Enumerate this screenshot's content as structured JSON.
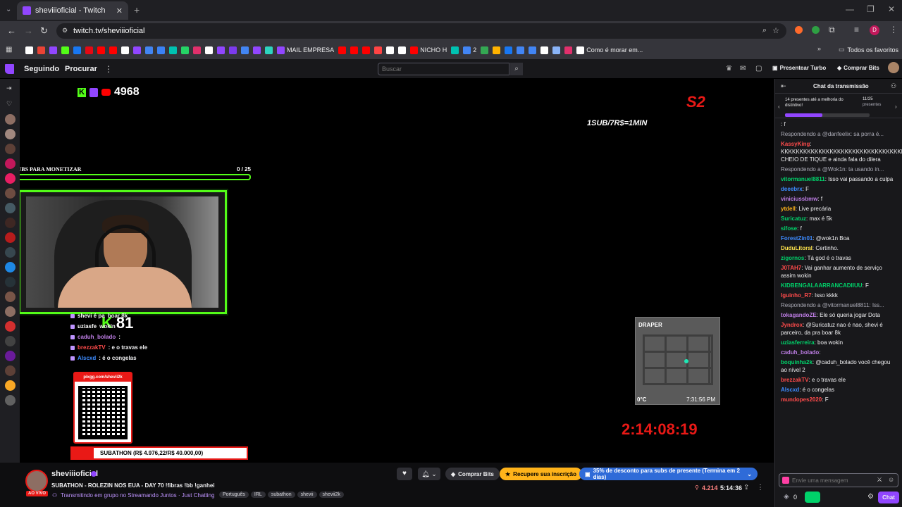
{
  "browser": {
    "tab_title": "sheviiioficial - Twitch",
    "url": "twitch.tv/sheviiioficial",
    "new_tab": "+",
    "bookmarks": [
      {
        "label": "",
        "color": "#ffffff"
      },
      {
        "label": "",
        "color": "#ea4335"
      },
      {
        "label": "",
        "color": "#9146ff"
      },
      {
        "label": "",
        "color": "#53fc18"
      },
      {
        "label": "",
        "color": "#1877f2"
      },
      {
        "label": "",
        "color": "#e50914"
      },
      {
        "label": "",
        "color": "#ff0000"
      },
      {
        "label": "",
        "color": "#ff0000"
      },
      {
        "label": "",
        "color": "#ffffff"
      },
      {
        "label": "",
        "color": "#9146ff"
      },
      {
        "label": "",
        "color": "#4285f4"
      },
      {
        "label": "",
        "color": "#3b82f6"
      },
      {
        "label": "",
        "color": "#00c2b2"
      },
      {
        "label": "",
        "color": "#25d366"
      },
      {
        "label": "",
        "color": "#e1306c"
      },
      {
        "label": "",
        "color": "#ffffff"
      },
      {
        "label": "",
        "color": "#9146ff"
      },
      {
        "label": "",
        "color": "#7c3aed"
      },
      {
        "label": "",
        "color": "#4285f4"
      },
      {
        "label": "",
        "color": "#9146ff"
      },
      {
        "label": "",
        "color": "#2dd4bf"
      },
      {
        "label": "MAIL EMPRESA",
        "color": "#9146ff"
      },
      {
        "label": "",
        "color": "#ff0000"
      },
      {
        "label": "",
        "color": "#ff0000"
      },
      {
        "label": "",
        "color": "#ff0000"
      },
      {
        "label": "",
        "color": "#ff4444"
      },
      {
        "label": "",
        "color": "#ffffff"
      },
      {
        "label": "",
        "color": "#ffffff"
      },
      {
        "label": "NICHO H",
        "color": "#ff0000"
      },
      {
        "label": "",
        "color": "#00c2b2"
      },
      {
        "label": "2",
        "color": "#4285f4"
      },
      {
        "label": "",
        "color": "#34a853"
      },
      {
        "label": "",
        "color": "#ffb300"
      },
      {
        "label": "",
        "color": "#1877f2"
      },
      {
        "label": "",
        "color": "#4285f4"
      },
      {
        "label": "",
        "color": "#4285f4"
      },
      {
        "label": "",
        "color": "#ffffff"
      },
      {
        "label": "",
        "color": "#8ab4f8"
      },
      {
        "label": "",
        "color": "#e1306c"
      },
      {
        "label": "Como é morar em...",
        "color": "#ffffff"
      }
    ],
    "all_favorites": "Todos os favoritos"
  },
  "twitch_header": {
    "following": "Seguindo",
    "browse": "Procurar",
    "search_placeholder": "Buscar",
    "turbo": "Presentear Turbo",
    "bits": "Comprar Bits"
  },
  "overlay": {
    "kick_count": "4968",
    "subs_label": "SUBS PARA MONETIZAR",
    "subs_progress": "0 / 25",
    "subs_fraction": 0,
    "sub_rate": "1SUB/7R$=1MIN",
    "kick_viewers": "81",
    "qr_label": "pixgg.com/shevii2k",
    "subathon": "SUBATHON (R$ 4.976,22/R$ 40.000,00)",
    "subathon_fraction": 0.124,
    "timer": "2:14:08:19",
    "map_title": "DRAPER",
    "map_temp": "0°C",
    "map_time": "7:31:56 PM",
    "stream_chat": [
      {
        "user": "shevi é pa",
        "text": "boar 8k",
        "color": "#ffffff"
      },
      {
        "user": "uziasfe",
        "text": "wokin",
        "color": "#ffffff"
      },
      {
        "user": "caduh_bolado",
        "text": ":",
        "color": "#bf7ee6"
      },
      {
        "user": "brezzakTV",
        "text": ": e o travas ele",
        "color": "#ff4b4b"
      },
      {
        "user": "Alscxd",
        "text": ": é o congelas",
        "color": "#3d8bff"
      }
    ]
  },
  "chat": {
    "header": "Chat da transmissão",
    "gifts": "14 presentes até a melhoria do distintivo!",
    "gift_count": "11/25",
    "gift_count_label": "presentes",
    "gift_fraction": 0.44,
    "messages": [
      {
        "reply": "",
        "user": "",
        "text": ": f",
        "color": "#ff4b4b"
      },
      {
        "reply": "Respondendo a @danfeelix: sa porra é...",
        "user": "",
        "text": "",
        "color": "#adadb8"
      },
      {
        "reply": "",
        "user": "KassyKing",
        "text": ": KKKKKKKKKKKKKKKKKKKKKKKKKKKKKKKKKK CHEIO DE TIQUE e ainda fala do dilera",
        "color": "#ff4b4b"
      },
      {
        "reply": "Respondendo a @Wok1n: ta usando in...",
        "user": "",
        "text": "",
        "color": "#adadb8"
      },
      {
        "reply": "",
        "user": "vitormanuel8811",
        "text": ": Isso vai passando a culpa",
        "color": "#00d26a"
      },
      {
        "reply": "",
        "user": "deeebrx",
        "text": ": F",
        "color": "#3d8bff"
      },
      {
        "reply": "",
        "user": "viniciussbmw",
        "text": ": f",
        "color": "#bf7ee6"
      },
      {
        "reply": "",
        "user": "ytdell",
        "text": ": Live precária",
        "color": "#ffb31a"
      },
      {
        "reply": "",
        "user": "Suricatuz",
        "text": ": max é 5k",
        "color": "#00d26a"
      },
      {
        "reply": "",
        "user": "sifose",
        "text": ": f",
        "color": "#00d26a"
      },
      {
        "reply": "",
        "user": "ForestZin01",
        "text": ": @wok1n Boa",
        "color": "#3d8bff"
      },
      {
        "reply": "",
        "user": "DuduLitoral",
        "text": ": Certinho.",
        "color": "#ffe44d"
      },
      {
        "reply": "",
        "user": "zigornos",
        "text": ": Tá god é o travas",
        "color": "#00d26a"
      },
      {
        "reply": "",
        "user": "J0TAH7",
        "text": ": Vai ganhar aumento de serviço assim wokin",
        "color": "#ff4b4b"
      },
      {
        "reply": "",
        "user": "KIDBENGALAARRANCADIIUU",
        "text": ": F",
        "color": "#00d26a"
      },
      {
        "reply": "",
        "user": "Iguinho_R7",
        "text": ": Isso kkkk",
        "color": "#ff4b4b"
      },
      {
        "reply": "Respondendo a @vitormanuel8811: Iss...",
        "user": "",
        "text": "",
        "color": "#adadb8"
      },
      {
        "reply": "",
        "user": "tokagandoZE",
        "text": ": Ele só queria jogar Dota",
        "color": "#bf7ee6"
      },
      {
        "reply": "",
        "user": "Jyndrox",
        "text": ": @Suricatuz nao é nao, shevi é parceiro, da pra boar 8k",
        "color": "#ff4b4b"
      },
      {
        "reply": "",
        "user": "uziasferreira",
        "text": ": boa wokin",
        "color": "#00d26a"
      },
      {
        "reply": "",
        "user": "caduh_bolado",
        "text": ":",
        "color": "#bf7ee6"
      },
      {
        "reply": "",
        "user": "boquinha2k",
        "text": ": @caduh_bolado você chegou ao nível 2",
        "color": "#00d26a"
      },
      {
        "reply": "",
        "user": "brezzakTV",
        "text": ": e o travas ele",
        "color": "#ff4b4b"
      },
      {
        "reply": "",
        "user": "Alscxd",
        "text": ": é o congelas",
        "color": "#3d8bff"
      },
      {
        "reply": "",
        "user": "mundopes2020",
        "text": ": F",
        "color": "#ff4b4b"
      }
    ],
    "input_placeholder": "Envie uma mensagem",
    "points": "0",
    "send": "Chat"
  },
  "channel": {
    "name": "sheviiioficial",
    "live_badge": "AO VIVO",
    "title": "SUBATHON - ROLEZIN NOS EUA - DAY 70 !fibras !bb !ganhei",
    "group": "Transmitindo em grupo no Streamando Juntos · Just Chatting",
    "tags": [
      "Português",
      "IRL",
      "subathon",
      "shevii",
      "shevii2k"
    ],
    "buy_bits": "Comprar Bits",
    "recover_sub": "Recupere sua inscrição",
    "discount": "35% de desconto para subs de presente (Termina em 2 dias)",
    "viewers": "4.214",
    "uptime": "5:14:36"
  },
  "colors": {
    "twitch": "#9146ff",
    "kick": "#53fc18",
    "accent_red": "#e91916"
  }
}
